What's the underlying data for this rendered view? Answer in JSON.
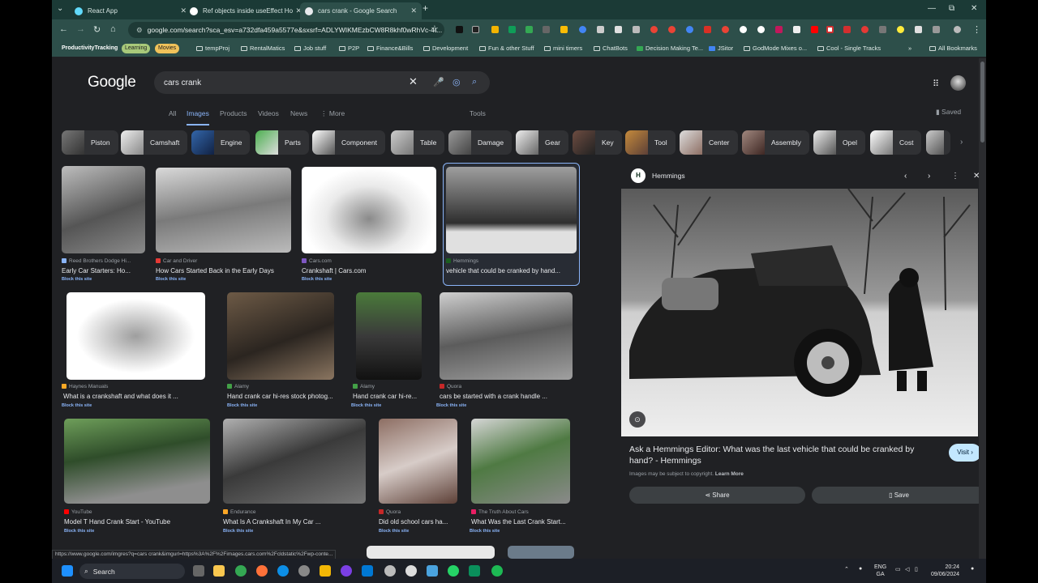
{
  "browser": {
    "tabs": [
      {
        "title": "React App",
        "active": false,
        "favicon_color": "#61dafb"
      },
      {
        "title": "Ref objects inside useEffect Ho",
        "active": false,
        "favicon_color": "#ffffff"
      },
      {
        "title": "cars crank - Google Search",
        "active": true,
        "favicon_color": "#e8eaed"
      }
    ],
    "new_tab_icon": "+",
    "url": "google.com/search?sca_esv=a732dfa459a5577e&sxsrf=ADLYWIKMEzbCW8R8khf0wRhVc-4t...",
    "bookmarks_chips": [
      {
        "label": "ProductivityTracking",
        "color": "#2d4f4a",
        "text_color": "#ffffff"
      },
      {
        "label": "Learning",
        "color": "#a8c97a",
        "text_color": "#1d1d1d"
      },
      {
        "label": "Movies",
        "color": "#f0c25a",
        "text_color": "#1d1d1d"
      }
    ],
    "bookmarks": [
      "tempProj",
      "RentalMatics",
      "Job stuff",
      "P2P",
      "Finance&Bills",
      "Development",
      "Fun & other Stuff",
      "mini timers",
      "ChatBots",
      "Decision Making Te...",
      "JSitor",
      "GodMode Mixes o...",
      "Cool - Single Tracks"
    ],
    "all_bookmarks": "All Bookmarks",
    "status_url": "https://www.google.com/imgres?q=cars crank&imgurl=https%3A%2F%2Fimages.cars.com%2Fcldstatic%2Fwp-conte..."
  },
  "search": {
    "logo": "Google",
    "query": "cars crank",
    "nav": [
      "All",
      "Images",
      "Products",
      "Videos",
      "News",
      "More"
    ],
    "active_nav": "Images",
    "tools": "Tools",
    "saved": "Saved"
  },
  "chips": [
    "Piston",
    "Camshaft",
    "Engine",
    "Parts",
    "Component",
    "Table",
    "Damage",
    "Gear",
    "Key",
    "Tool",
    "Center",
    "Assembly",
    "Opel",
    "Cost"
  ],
  "results": [
    {
      "source": "Reed Brothers Dodge Hi...",
      "title": "Early Car Starters: Ho...",
      "block": "Block this site",
      "src_color": "#8ab4f8"
    },
    {
      "source": "Car and Driver",
      "title": "How Cars Started Back in the Early Days",
      "block": "Block this site",
      "src_color": "#e53935"
    },
    {
      "source": "Cars.com",
      "title": "Crankshaft | Cars.com",
      "block": "Block this site",
      "src_color": "#7e57c2"
    },
    {
      "source": "Hemmings",
      "title": "vehicle that could be cranked by hand...",
      "block": "",
      "src_color": "#1b5e20"
    },
    {
      "source": "Haynes Manuals",
      "title": "What is a crankshaft and what does it ...",
      "block": "Block this site",
      "src_color": "#f9a825"
    },
    {
      "source": "Alamy",
      "title": "Hand crank car hi-res stock photog...",
      "block": "Block this site",
      "src_color": "#43a047"
    },
    {
      "source": "Alamy",
      "title": "Hand crank car hi-re...",
      "block": "Block this site",
      "src_color": "#43a047"
    },
    {
      "source": "Quora",
      "title": "cars be started with a crank handle ...",
      "block": "Block this site",
      "src_color": "#c62828"
    },
    {
      "source": "YouTube",
      "title": "Model T Hand Crank Start - YouTube",
      "block": "Block this site",
      "src_color": "#ff0000"
    },
    {
      "source": "Endurance",
      "title": "What Is A Crankshaft In My Car ...",
      "block": "Block this site",
      "src_color": "#ffa726"
    },
    {
      "source": "Quora",
      "title": "Did old school cars ha...",
      "block": "Block this site",
      "src_color": "#c62828"
    },
    {
      "source": "The Truth About Cars",
      "title": "What Was the Last Crank Start...",
      "block": "Block this site",
      "src_color": "#e91e63"
    }
  ],
  "preview": {
    "source": "Hemmings",
    "logo_letter": "H",
    "title": "Ask a Hemmings Editor: What was the last vehicle that could be cranked by hand? - Hemmings",
    "visit": "Visit",
    "copyright": "Images may be subject to copyright.",
    "learn_more": "Learn More",
    "share": "Share",
    "save": "Save"
  },
  "taskbar": {
    "search": "Search",
    "lang_top": "ENG",
    "lang_bottom": "GA",
    "time": "20:24",
    "date": "09/06/2024"
  }
}
